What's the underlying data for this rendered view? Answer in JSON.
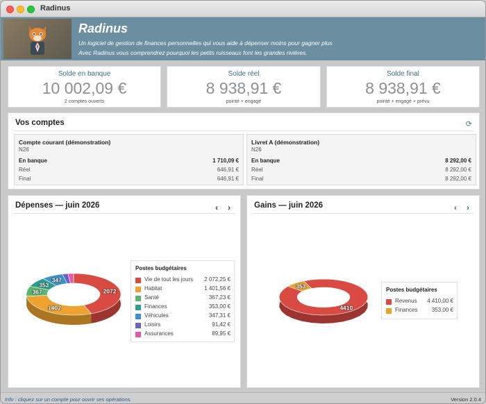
{
  "window": {
    "title": "Radinus"
  },
  "banner": {
    "app_name": "Radinus",
    "tagline1": "Un logiciel de gestion de finances personnelles qui vous aide à dépenser moins pour gagner plus",
    "tagline2": "Avec Radinus vous comprendrez pourquoi les petits ruisseaux font les grandes rivières."
  },
  "kpis": [
    {
      "label": "Solde en banque",
      "value": "10 002,09 €",
      "sub": "2 comptes ouverts"
    },
    {
      "label": "Solde réel",
      "value": "8 938,91 €",
      "sub": "pointé + engagé"
    },
    {
      "label": "Solde final",
      "value": "8 938,91 €",
      "sub": "pointé + engagé + prévu"
    }
  ],
  "accounts_section": {
    "title": "Vos comptes",
    "refresh_icon": "refresh-icon",
    "accounts": [
      {
        "name": "Compte courant (démonstration)",
        "bank": "N26",
        "rows": [
          {
            "label": "En banque",
            "value": "1 710,09 €"
          },
          {
            "label": "Réel",
            "value": "646,91 €"
          },
          {
            "label": "Final",
            "value": "646,91 €"
          }
        ]
      },
      {
        "name": "Livret A (démonstration)",
        "bank": "N26",
        "rows": [
          {
            "label": "En banque",
            "value": "8 292,00 €"
          },
          {
            "label": "Réel",
            "value": "8 292,00 €"
          },
          {
            "label": "Final",
            "value": "8 292,00 €"
          }
        ]
      }
    ]
  },
  "expenses": {
    "title": "Dépenses — juin 2026",
    "prev_icon": "‹",
    "next_icon": "›",
    "legend_title": "Postes budgétaires",
    "items": [
      {
        "name": "Vie de tout les jours",
        "amount": "2 072,25 €",
        "value": 2072.25,
        "color": "#d94a43",
        "label": "2072"
      },
      {
        "name": "Habitat",
        "amount": "1 401,56 €",
        "value": 1401.56,
        "color": "#eea22f",
        "label": "1402"
      },
      {
        "name": "Santé",
        "amount": "367,23 €",
        "value": 367.23,
        "color": "#5ab56e",
        "label": "367"
      },
      {
        "name": "Finances",
        "amount": "353,00 €",
        "value": 353.0,
        "color": "#2c9c8e",
        "label": "353"
      },
      {
        "name": "Véhicules",
        "amount": "347,31 €",
        "value": 347.31,
        "color": "#3d92c9",
        "label": "347"
      },
      {
        "name": "Loisirs",
        "amount": "91,42 €",
        "value": 91.42,
        "color": "#6e5fc1",
        "label": ""
      },
      {
        "name": "Assurances",
        "amount": "89,95 €",
        "value": 89.95,
        "color": "#e05aa8",
        "label": ""
      }
    ]
  },
  "income": {
    "title": "Gains — juin 2026",
    "prev_icon": "‹",
    "next_icon": "›",
    "legend_title": "Postes budgétaires",
    "items": [
      {
        "name": "Revenus",
        "amount": "4 410,00 €",
        "value": 4410.0,
        "color": "#d94a43",
        "label": "4410"
      },
      {
        "name": "Finances",
        "amount": "353,00 €",
        "value": 353.0,
        "color": "#eea22f",
        "label": "353"
      }
    ]
  },
  "status": {
    "info": "Info : cliquez sur un compte pour ouvrir ses opérations.",
    "version": "Version 2.0.4"
  }
}
